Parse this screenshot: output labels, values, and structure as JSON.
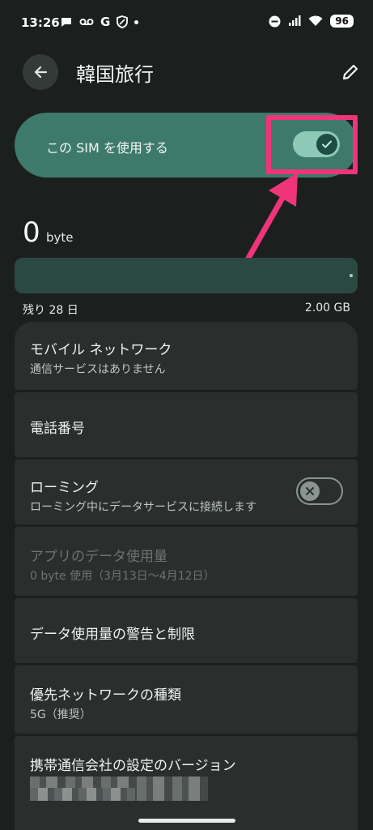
{
  "status_bar": {
    "time": "13:26",
    "g_letter": "G",
    "battery": "96",
    "icons_left": [
      "chat-bubble-icon",
      "voicemail-icon",
      "google-icon",
      "shield-icon",
      "dot-icon"
    ],
    "icons_right": [
      "dnd-icon",
      "signal-icon",
      "wifi-icon",
      "battery-icon"
    ]
  },
  "app_bar": {
    "title": "韓国旅行",
    "back_icon": "arrow-left-icon",
    "edit_icon": "pencil-icon"
  },
  "sim_toggle": {
    "label": "この SIM を使用する",
    "checked": true,
    "accent": "#3d7a6c",
    "highlight_color": "#f0347a"
  },
  "usage": {
    "amount": "0",
    "unit": "byte",
    "days_left": "残り 28 日",
    "limit": "2.00 GB"
  },
  "settings": {
    "mobile_network": {
      "title": "モバイル ネットワーク",
      "subtitle": "通信サービスはありません"
    },
    "phone_number": {
      "title": "電話番号"
    },
    "roaming": {
      "title": "ローミング",
      "subtitle": "ローミング中にデータサービスに接続します",
      "checked": false
    },
    "app_data_usage": {
      "title": "アプリのデータ使用量",
      "subtitle": "0 byte 使用（3月13日〜4月12日）"
    },
    "data_warning": {
      "title": "データ使用量の警告と制限"
    },
    "preferred_network": {
      "title": "優先ネットワークの種類",
      "subtitle": "5G（推奨）"
    },
    "carrier_version": {
      "title": "携帯通信会社の設定のバージョン"
    }
  }
}
